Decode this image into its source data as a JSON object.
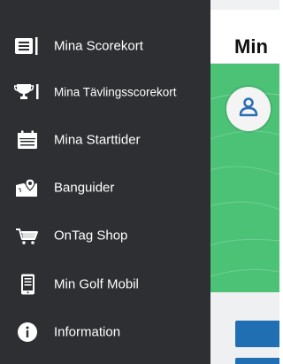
{
  "menu": {
    "items": [
      {
        "label": "Mina Scorekort",
        "icon": "scorecard-icon"
      },
      {
        "label": "Mina Tävlingsscorekort",
        "icon": "trophy-icon"
      },
      {
        "label": "Mina Starttider",
        "icon": "calendar-icon"
      },
      {
        "label": "Banguider",
        "icon": "map-icon"
      },
      {
        "label": "OnTag Shop",
        "icon": "cart-icon"
      },
      {
        "label": "Min Golf Mobil",
        "icon": "mobile-icon"
      },
      {
        "label": "Information",
        "icon": "info-icon"
      }
    ]
  },
  "main": {
    "title": "Min"
  },
  "colors": {
    "sidebar_bg": "#2d2f32",
    "banner_green": "#4cc277",
    "button_blue": "#1f6fb2",
    "avatar_blue": "#2a6eb5"
  }
}
